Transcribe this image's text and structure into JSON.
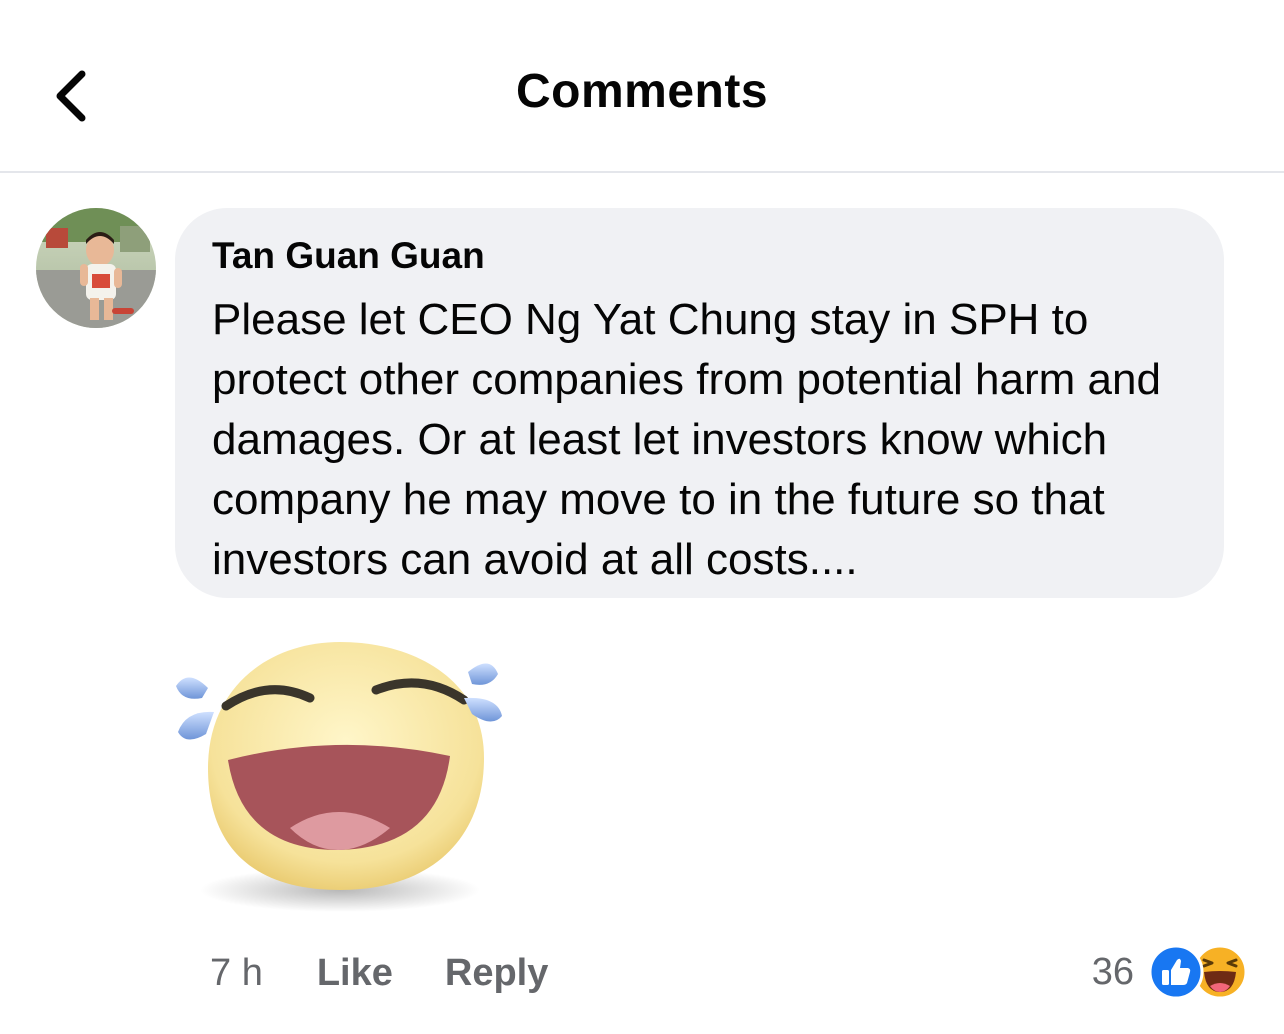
{
  "header": {
    "title": "Comments",
    "back_icon": "chevron-left-icon"
  },
  "comment": {
    "author": "Tan Guan Guan",
    "text": "Please let CEO Ng Yat Chung stay in SPH to protect other companies from potential harm and damages. Or at least let investors know which company he may move to in the future so that investors can avoid at all costs....",
    "sticker": "laughing-crying-face-sticker",
    "time": "7 h",
    "like_label": "Like",
    "reply_label": "Reply",
    "reaction_count": "36",
    "reactions": [
      "like-reaction-icon",
      "haha-reaction-icon"
    ]
  },
  "colors": {
    "bubble": "#f0f1f4",
    "secondary_text": "#65676b",
    "like_blue": "#1877f2",
    "haha_yellow": "#f7b125"
  }
}
